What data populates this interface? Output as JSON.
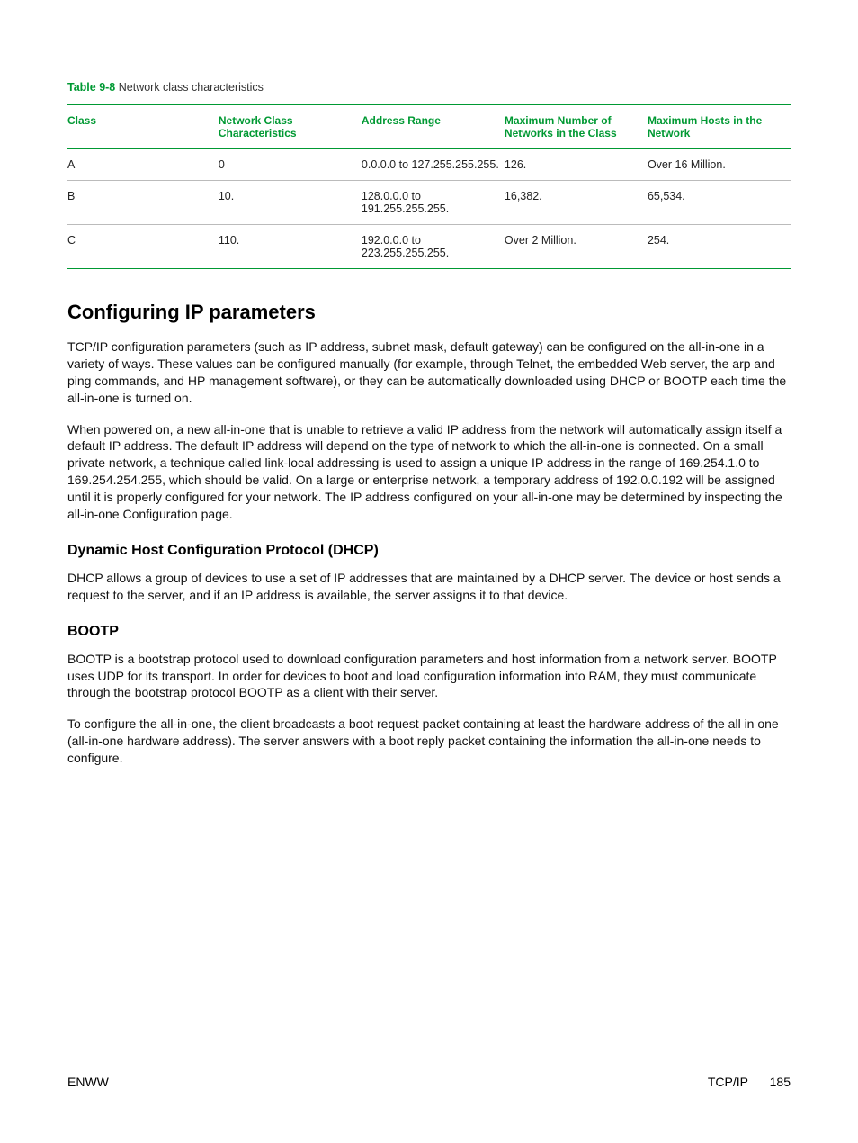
{
  "table": {
    "caption_num": "Table 9-8",
    "caption_txt": "  Network class characteristics",
    "headers": [
      "Class",
      "Network Class Characteristics",
      "Address Range",
      "Maximum Number of Networks in the Class",
      "Maximum Hosts in the Network"
    ],
    "rows": [
      [
        "A",
        "0",
        "0.0.0.0 to 127.255.255.255.",
        "126.",
        "Over 16 Million."
      ],
      [
        "B",
        "10.",
        "128.0.0.0 to 191.255.255.255.",
        "16,382.",
        "65,534."
      ],
      [
        "C",
        "110.",
        "192.0.0.0 to 223.255.255.255.",
        "Over 2 Million.",
        "254."
      ]
    ]
  },
  "h2": "Configuring IP parameters",
  "p1": "TCP/IP configuration parameters (such as IP address, subnet mask, default gateway) can be configured on the all-in-one in a variety of ways. These values can be configured manually (for example, through Telnet, the embedded Web server, the arp and ping commands, and HP management software), or they can be automatically downloaded using DHCP or BOOTP each time the all-in-one is turned on.",
  "p2": "When powered on, a new all-in-one that is unable to retrieve a valid IP address from the network will automatically assign itself a default IP address. The default IP address will depend on the type of network to which the all-in-one is connected. On a small private network, a technique called link-local addressing is used to assign a unique IP address in the range of 169.254.1.0 to 169.254.254.255, which should be valid. On a large or enterprise network, a temporary address of 192.0.0.192 will be assigned until it is properly configured for your network. The IP address configured on your all-in-one may be determined by inspecting the all-in-one Configuration page.",
  "h3a": "Dynamic Host Configuration Protocol (DHCP)",
  "p3": "DHCP allows a group of devices to use a set of IP addresses that are maintained by a DHCP server. The device or host sends a request to the server, and if an IP address is available, the server assigns it to that device.",
  "h3b": "BOOTP",
  "p4": "BOOTP is a bootstrap protocol used to download configuration parameters and host information from a network server. BOOTP uses UDP for its transport. In order for devices to boot and load configuration information into RAM, they must communicate through the bootstrap protocol BOOTP as a client with their server.",
  "p5": "To configure the all-in-one, the client broadcasts a boot request packet containing at least the hardware address of the all in one (all-in-one hardware address). The server answers with a boot reply packet containing the information the all-in-one needs to configure.",
  "footer": {
    "left": "ENWW",
    "right_label": "TCP/IP",
    "right_page": "185"
  }
}
